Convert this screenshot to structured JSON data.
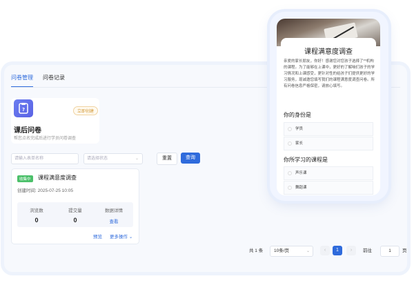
{
  "tabs": [
    "问卷管理",
    "问卷记录"
  ],
  "survey": {
    "badge": "立即创建",
    "title": "课后问卷",
    "desc": "帮您点名完成后进行学员问卷调查"
  },
  "filters": {
    "name_placeholder": "请输入表单名称",
    "status_placeholder": "请选择状态",
    "reset": "重置",
    "query": "查询"
  },
  "result": {
    "status": "收集中",
    "name": "课程满意度调查",
    "created": "创建时间: 2025-07-25 10:05",
    "stats": [
      {
        "label": "浏览数",
        "value": "0"
      },
      {
        "label": "提交量",
        "value": "0"
      },
      {
        "label": "数据详情",
        "link": "查看"
      }
    ],
    "preview": "预览",
    "more": "更多操作"
  },
  "pager": {
    "total": "共 1 条",
    "page_size": "10条/页",
    "current": "1",
    "goto_label": "前往",
    "goto_value": "1",
    "page_unit": "页",
    "prev": "‹",
    "next": "›"
  },
  "phone": {
    "title": "课程满意度调查",
    "intro": "亲爱的家长朋友，你好！感谢您对您孩子选择了**机构的课程。为了能够在上课中，更好的了解咱们孩子的学习情况和上课感受，更针对性的给孩子们提供更好的学习服务，现诚邀您填写我们的课程满意度调查问卷。所有问卷信息严格保密，请放心填写。",
    "q1": {
      "title": "你的身份是",
      "options": [
        "学员",
        "家长"
      ]
    },
    "q2": {
      "title": "你所学习的课程是",
      "options": [
        "声乐课",
        "舞蹈课"
      ]
    }
  },
  "colors": {
    "accent": "#2f6bdc",
    "status_green": "#4cc06a",
    "badge_orange": "#d39a3a"
  }
}
